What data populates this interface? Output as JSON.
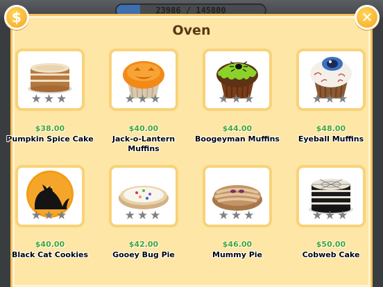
{
  "header": {
    "xp_text": "23986 / 145800",
    "xp_progress": 0.16
  },
  "panel": {
    "title": "Oven",
    "coin_button_symbol": "$",
    "close_button_symbol": "✕"
  },
  "items": [
    {
      "name": "Pumpkin Spice Cake",
      "price": "$38.00",
      "stars": "★★★",
      "icon": "pumpkin-spice-cake-icon"
    },
    {
      "name": "Jack-o-Lantern Muffins",
      "price": "$40.00",
      "stars": "★★★",
      "icon": "jack-o-lantern-muffin-icon"
    },
    {
      "name": "Boogeyman Muffins",
      "price": "$44.00",
      "stars": "★★★",
      "icon": "boogeyman-muffin-icon"
    },
    {
      "name": "Eyeball Muffins",
      "price": "$48.00",
      "stars": "★★★",
      "icon": "eyeball-muffin-icon"
    },
    {
      "name": "Black Cat Cookies",
      "price": "$40.00",
      "stars": "★★★",
      "icon": "black-cat-cookie-icon"
    },
    {
      "name": "Gooey Bug Pie",
      "price": "$42.00",
      "stars": "★★★",
      "icon": "gooey-bug-pie-icon"
    },
    {
      "name": "Mummy Pie",
      "price": "$46.00",
      "stars": "★★★",
      "icon": "mummy-pie-icon"
    },
    {
      "name": "Cobweb Cake",
      "price": "$50.00",
      "stars": "★★★",
      "icon": "cobweb-cake-icon"
    }
  ],
  "colors": {
    "panel_bg": "#fde6a6",
    "panel_border": "#f4c05a",
    "price_green": "#47a327",
    "title_brown": "#5a3615",
    "star_gray": "#7e8082"
  }
}
